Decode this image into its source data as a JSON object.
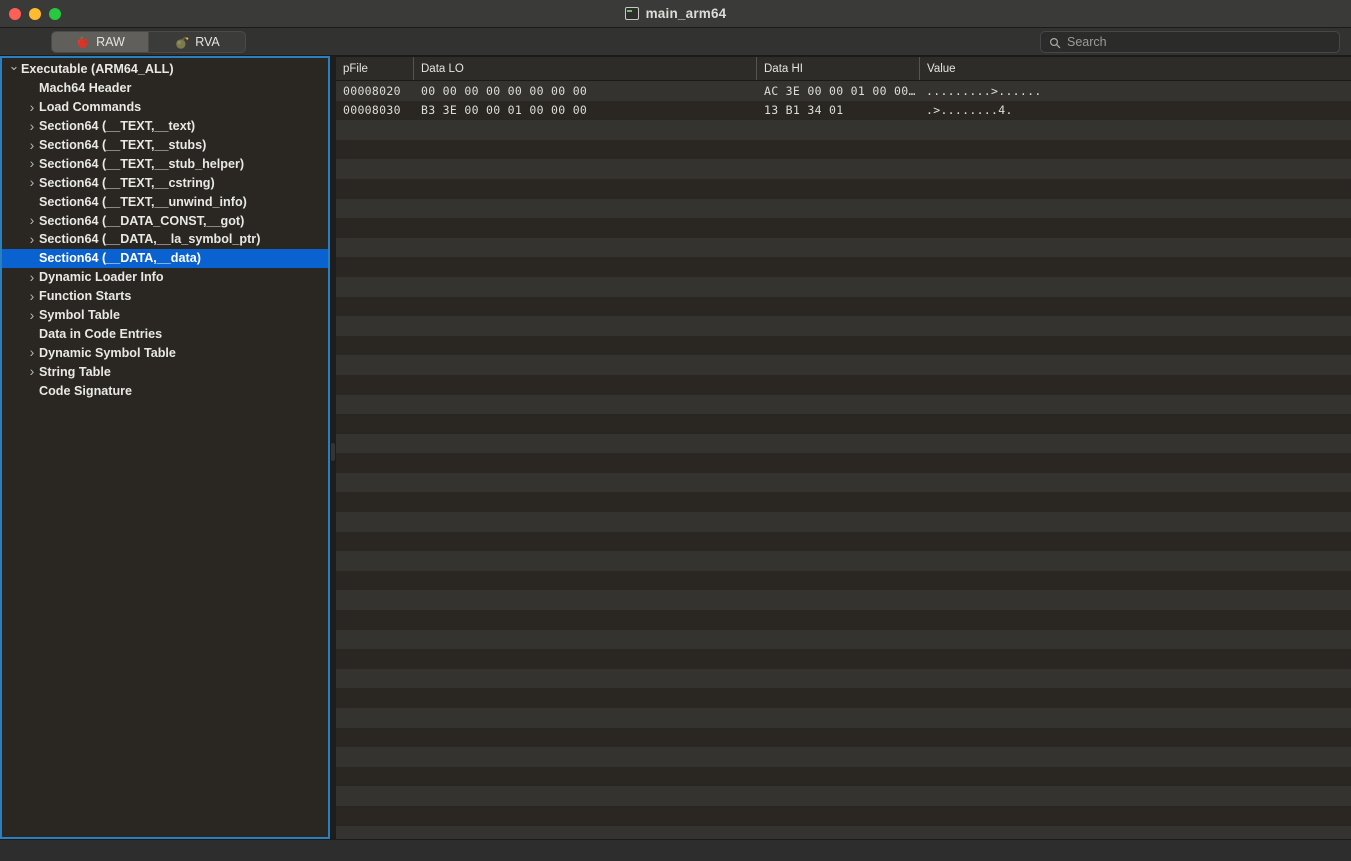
{
  "window": {
    "title": "main_arm64",
    "doc_icon": "terminal-document-icon",
    "traffic_lights": [
      {
        "name": "close",
        "color": "#ff5f57"
      },
      {
        "name": "minimize",
        "color": "#febc2e"
      },
      {
        "name": "maximize",
        "color": "#28c840"
      }
    ]
  },
  "toolbar": {
    "tabs": [
      {
        "label": "RAW",
        "icon": "apple-icon",
        "selected": true
      },
      {
        "label": "RVA",
        "icon": "bomb-icon",
        "selected": false
      }
    ],
    "search": {
      "placeholder": "Search",
      "value": "",
      "icon": "search-icon"
    }
  },
  "sidebar": {
    "focus_border_color": "#2a7fbe",
    "selection_color": "#0a62d0",
    "items": [
      {
        "label": "Executable  (ARM64_ALL)",
        "indent": 0,
        "twisty": "open",
        "selected": false
      },
      {
        "label": "Mach64 Header",
        "indent": 1,
        "twisty": "none",
        "selected": false
      },
      {
        "label": "Load Commands",
        "indent": 1,
        "twisty": "closed",
        "selected": false
      },
      {
        "label": "Section64 (__TEXT,__text)",
        "indent": 1,
        "twisty": "closed",
        "selected": false
      },
      {
        "label": "Section64 (__TEXT,__stubs)",
        "indent": 1,
        "twisty": "closed",
        "selected": false
      },
      {
        "label": "Section64 (__TEXT,__stub_helper)",
        "indent": 1,
        "twisty": "closed",
        "selected": false
      },
      {
        "label": "Section64 (__TEXT,__cstring)",
        "indent": 1,
        "twisty": "closed",
        "selected": false
      },
      {
        "label": "Section64 (__TEXT,__unwind_info)",
        "indent": 1,
        "twisty": "none",
        "selected": false
      },
      {
        "label": "Section64 (__DATA_CONST,__got)",
        "indent": 1,
        "twisty": "closed",
        "selected": false
      },
      {
        "label": "Section64 (__DATA,__la_symbol_ptr)",
        "indent": 1,
        "twisty": "closed",
        "selected": false
      },
      {
        "label": "Section64 (__DATA,__data)",
        "indent": 1,
        "twisty": "none",
        "selected": true
      },
      {
        "label": "Dynamic Loader Info",
        "indent": 1,
        "twisty": "closed",
        "selected": false
      },
      {
        "label": "Function Starts",
        "indent": 1,
        "twisty": "closed",
        "selected": false
      },
      {
        "label": "Symbol Table",
        "indent": 1,
        "twisty": "closed",
        "selected": false
      },
      {
        "label": "Data in Code Entries",
        "indent": 1,
        "twisty": "none",
        "selected": false
      },
      {
        "label": "Dynamic Symbol Table",
        "indent": 1,
        "twisty": "closed",
        "selected": false
      },
      {
        "label": "String Table",
        "indent": 1,
        "twisty": "closed",
        "selected": false
      },
      {
        "label": "Code Signature",
        "indent": 1,
        "twisty": "none",
        "selected": false
      }
    ]
  },
  "table": {
    "columns": [
      {
        "key": "pfile",
        "label": "pFile"
      },
      {
        "key": "lo",
        "label": "Data LO"
      },
      {
        "key": "hi",
        "label": "Data HI"
      },
      {
        "key": "value",
        "label": "Value"
      }
    ],
    "rows": [
      {
        "pfile": "00008020",
        "lo": "00 00 00 00 00 00 00 00",
        "hi": "AC 3E 00 00 01 00 00…",
        "value": ".........>......"
      },
      {
        "pfile": "00008030",
        "lo": "B3 3E 00 00 01 00 00 00",
        "hi": "13 B1 34 01",
        "value": ".>........4."
      }
    ],
    "empty_row_count": 38
  }
}
